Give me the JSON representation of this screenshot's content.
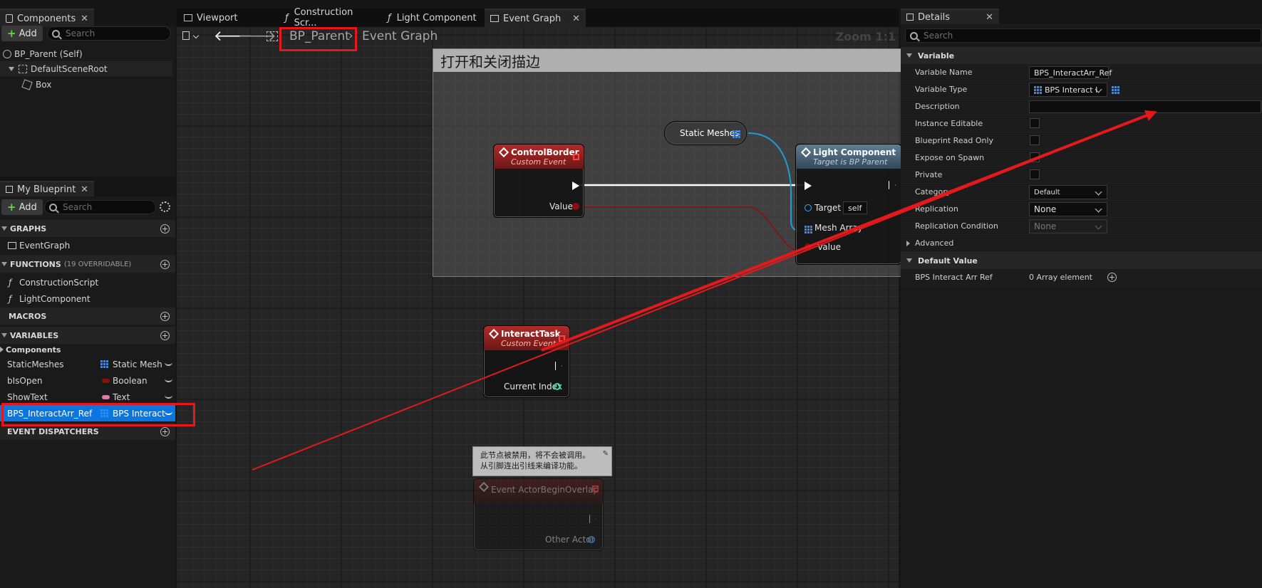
{
  "components_panel": {
    "tab_title": "Components",
    "add_label": "Add",
    "search_placeholder": "Search",
    "tree": [
      "BP_Parent (Self)",
      "DefaultSceneRoot",
      "Box"
    ]
  },
  "graph_tabs": [
    "Viewport",
    "Construction Scr...",
    "Light Component",
    "Event Graph"
  ],
  "graph_toolbar": {
    "breadcrumb_root": "BP_Parent",
    "breadcrumb_current": "Event Graph",
    "zoom": "Zoom 1:1"
  },
  "my_blueprint": {
    "tab_title": "My Blueprint",
    "add_label": "Add",
    "search_placeholder": "Search",
    "sections": {
      "graphs": "GRAPHS",
      "functions": "FUNCTIONS",
      "functions_note": "(19 OVERRIDABLE)",
      "macros": "MACROS",
      "variables": "VARIABLES",
      "event_dispatchers": "EVENT DISPATCHERS"
    },
    "graphs_items": [
      "EventGraph"
    ],
    "function_items": [
      "ConstructionScript",
      "LightComponent"
    ],
    "variable_category": "Components",
    "variables": [
      {
        "name": "StaticMeshes",
        "type": "Static Mesh",
        "color": "#2a8dff"
      },
      {
        "name": "bIsOpen",
        "type": "Boolean",
        "color": "#8f0d0d"
      },
      {
        "name": "ShowText",
        "type": "Text",
        "color": "#e877a8"
      },
      {
        "name": "BPS_InteractArr_Ref",
        "type": "BPS Interact",
        "color": "#2a8dff"
      }
    ]
  },
  "graph": {
    "comment_title": "打开和关闭描边",
    "nodes": {
      "control_border": {
        "title": "ControlBorder",
        "subtitle": "Custom Event",
        "pin": "Value"
      },
      "static_meshes": {
        "title": "Static Meshes"
      },
      "light_component": {
        "title": "Light Component",
        "subtitle": "Target is BP Parent",
        "pins": [
          "Target",
          "Mesh Array",
          "Value"
        ],
        "target_default": "self"
      },
      "interact_task": {
        "title": "InteractTask",
        "subtitle": "Custom Event",
        "pin": "Current Index"
      },
      "disabled_note_line1": "此节点被禁用，将不会被调用。",
      "disabled_note_line2": "从引脚连出引线来编译功能。",
      "begin_overlap": {
        "title": "Event ActorBeginOverlap",
        "pin": "Other Actor"
      }
    }
  },
  "details": {
    "tab_title": "Details",
    "search_placeholder": "Search",
    "section_variable": "Variable",
    "rows": {
      "variable_name_label": "Variable Name",
      "variable_name_value": "BPS_InteractArr_Ref",
      "variable_type_label": "Variable Type",
      "variable_type_value": "BPS Interact I",
      "description_label": "Description",
      "instance_editable_label": "Instance Editable",
      "read_only_label": "Blueprint Read Only",
      "expose_label": "Expose on Spawn",
      "private_label": "Private",
      "category_label": "Category",
      "category_value": "Default",
      "replication_label": "Replication",
      "replication_value": "None",
      "replication_condition_label": "Replication Condition",
      "replication_condition_value": "None",
      "advanced_label": "Advanced"
    },
    "section_default": "Default Value",
    "default_row_label": "BPS Interact Arr Ref",
    "default_row_value": "0 Array element"
  },
  "colors": {
    "selection": "#0c76e0",
    "annotation_red": "#e5191c",
    "exec_white": "#ffffff",
    "struct_blue": "#2a8dff",
    "bool_red": "#8f0d0d"
  }
}
